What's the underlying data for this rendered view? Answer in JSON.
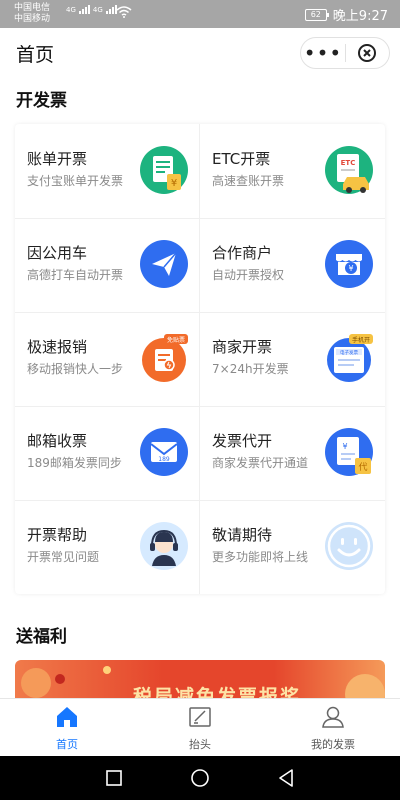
{
  "status": {
    "carrier1": "中国电信",
    "carrier2": "中国移动",
    "net1": "4G",
    "net2": "4G",
    "battery": "62",
    "time": "晚上9:27"
  },
  "header": {
    "title": "首页"
  },
  "sections": {
    "invoice": "开发票",
    "welfare": "送福利"
  },
  "grid": [
    {
      "title": "账单开票",
      "subtitle": "支付宝账单开发票",
      "icon": "bill-receipt-icon"
    },
    {
      "title": "ETC开票",
      "subtitle": "高速查账开票",
      "icon": "etc-car-icon",
      "badge": "ETC"
    },
    {
      "title": "因公用车",
      "subtitle": "高德打车自动开票",
      "icon": "paper-plane-icon"
    },
    {
      "title": "合作商户",
      "subtitle": "自动开票授权",
      "icon": "storefront-icon",
      "badge": "¥"
    },
    {
      "title": "极速报销",
      "subtitle": "移动报销快人一步",
      "icon": "reimburse-doc-icon",
      "badge": "免贴票"
    },
    {
      "title": "商家开票",
      "subtitle": "7×24h开发票",
      "icon": "phone-invoice-icon",
      "badge": "手机开",
      "doc": "电子发票"
    },
    {
      "title": "邮箱收票",
      "subtitle": "189邮箱发票同步",
      "icon": "mail-icon",
      "badge": "189"
    },
    {
      "title": "发票代开",
      "subtitle": "商家发票代开通道",
      "icon": "invoice-proxy-icon",
      "badge": "代"
    },
    {
      "title": "开票帮助",
      "subtitle": "开票常见问题",
      "icon": "headset-support-icon"
    },
    {
      "title": "敬请期待",
      "subtitle": "更多功能即将上线",
      "icon": "smiley-icon"
    }
  ],
  "banner": {
    "text": "税局减免发票报奖"
  },
  "tabs": [
    {
      "label": "首页",
      "active": true
    },
    {
      "label": "抬头",
      "active": false
    },
    {
      "label": "我的发票",
      "active": false
    }
  ],
  "colors": {
    "accent": "#1677ff",
    "blue_icon": "#2f6df0",
    "orange_icon": "#f26b2a",
    "green_icon": "#1db37f"
  }
}
